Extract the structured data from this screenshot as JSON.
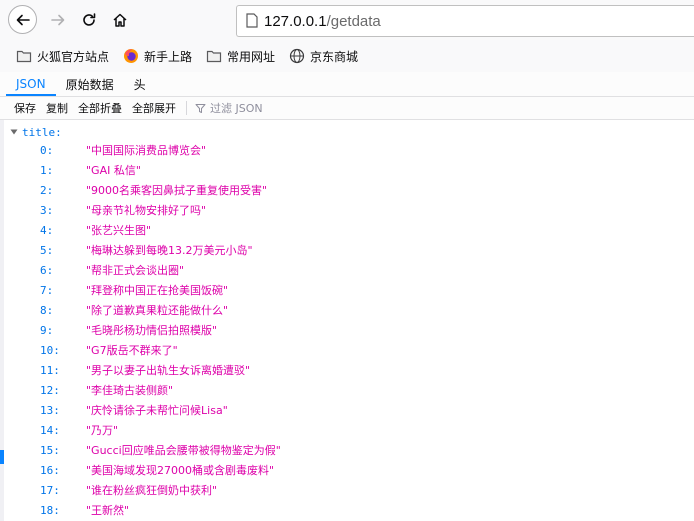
{
  "browser": {
    "url_host": "127.0.0.1",
    "url_path": "/getdata"
  },
  "bookmarks": [
    {
      "label": "火狐官方站点",
      "icon": "folder-icon"
    },
    {
      "label": "新手上路",
      "icon": "firefox-icon"
    },
    {
      "label": "常用网址",
      "icon": "folder-icon"
    },
    {
      "label": "京东商城",
      "icon": "globe-icon"
    }
  ],
  "viewer_tabs": [
    {
      "label": "JSON",
      "active": true
    },
    {
      "label": "原始数据",
      "active": false
    },
    {
      "label": "头",
      "active": false
    }
  ],
  "actions": {
    "save": "保存",
    "copy": "复制",
    "collapse_all": "全部折叠",
    "expand_all": "全部展开",
    "filter_placeholder": "过滤 JSON"
  },
  "json": {
    "root_key": "title:",
    "items": [
      {
        "index": "0:",
        "value": "\"中国国际消费品博览会\""
      },
      {
        "index": "1:",
        "value": "\"GAI 私信\""
      },
      {
        "index": "2:",
        "value": "\"9000名乘客因鼻拭子重复使用受害\""
      },
      {
        "index": "3:",
        "value": "\"母亲节礼物安排好了吗\""
      },
      {
        "index": "4:",
        "value": "\"张艺兴生图\""
      },
      {
        "index": "5:",
        "value": "\"梅琳达躲到每晚13.2万美元小岛\""
      },
      {
        "index": "6:",
        "value": "\"帮非正式会谈出圈\""
      },
      {
        "index": "7:",
        "value": "\"拜登称中国正在抢美国饭碗\""
      },
      {
        "index": "8:",
        "value": "\"除了道歉真果粒还能做什么\""
      },
      {
        "index": "9:",
        "value": "\"毛晓彤杨玏情侣拍照模版\""
      },
      {
        "index": "10:",
        "value": "\"G7版岳不群来了\""
      },
      {
        "index": "11:",
        "value": "\"男子以妻子出轨生女诉离婚遭驳\""
      },
      {
        "index": "12:",
        "value": "\"李佳琦古装侧颜\""
      },
      {
        "index": "13:",
        "value": "\"庆怜请徐子未帮忙问候Lisa\""
      },
      {
        "index": "14:",
        "value": "\"乃万\""
      },
      {
        "index": "15:",
        "value": "\"Gucci回应唯品会腰带被得物鉴定为假\""
      },
      {
        "index": "16:",
        "value": "\"美国海域发现27000桶或含剧毒废料\""
      },
      {
        "index": "17:",
        "value": "\"谁在粉丝疯狂倒奶中获利\""
      },
      {
        "index": "18:",
        "value": "\"王新然\""
      }
    ]
  }
}
